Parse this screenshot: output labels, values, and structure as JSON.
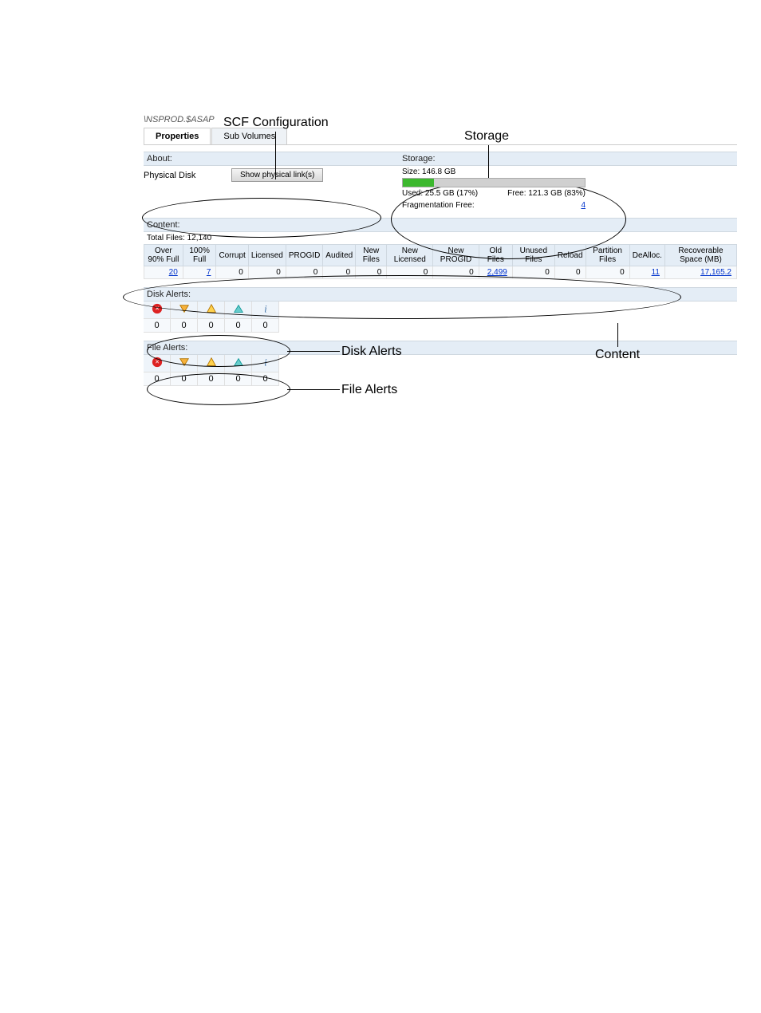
{
  "annotations": {
    "scf": "SCF Configuration",
    "storage": "Storage",
    "disk_alerts": "Disk Alerts",
    "file_alerts": "File Alerts",
    "content": "Content"
  },
  "header": {
    "path": "\\NSPROD.$ASAP"
  },
  "tabs": {
    "properties": "Properties",
    "subvolumes": "Sub Volumes"
  },
  "about": {
    "header": "About:",
    "physical_disk_label": "Physical Disk",
    "show_physical_link_btn": "Show physical link(s)"
  },
  "storage": {
    "header": "Storage:",
    "size_label": "Size: 146.8 GB",
    "used_label": "Used: 25.5 GB (17%)",
    "free_label": "Free: 121.3 GB (83%)",
    "frag_label": "Fragmentation Free:",
    "frag_value": "4"
  },
  "content": {
    "header": "Content:",
    "total_files_label": "Total Files: 12,140",
    "columns": [
      "Over 90% Full",
      "100% Full",
      "Corrupt",
      "Licensed",
      "PROGID",
      "Audited",
      "New Files",
      "New Licensed",
      "New PROGID",
      "Old Files",
      "Unused Files",
      "Reload",
      "Partition Files",
      "DeAlloc.",
      "Recoverable Space (MB)"
    ],
    "values": [
      "20",
      "7",
      "0",
      "0",
      "0",
      "0",
      "0",
      "0",
      "0",
      "2,499",
      "0",
      "0",
      "0",
      "11",
      "17,165.2"
    ],
    "links": [
      0,
      1,
      9,
      13,
      14
    ]
  },
  "disk_alerts": {
    "header": "Disk Alerts:",
    "values": [
      "0",
      "0",
      "0",
      "0",
      "0"
    ]
  },
  "file_alerts": {
    "header": "File Alerts:",
    "values": [
      "0",
      "0",
      "0",
      "0",
      "0"
    ]
  }
}
